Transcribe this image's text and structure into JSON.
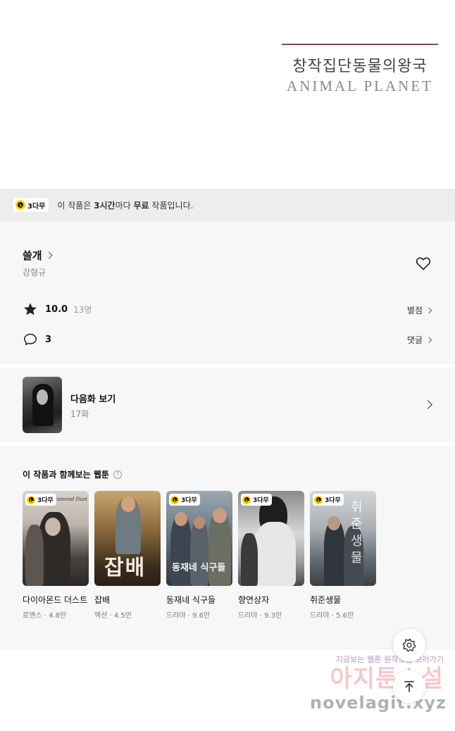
{
  "logo": {
    "kr": "창작집단동물의왕국",
    "en": "ANIMAL PLANET"
  },
  "notice": {
    "badge": "3다무",
    "text_prefix": "이 작품은 ",
    "text_hours": "3시간",
    "text_mid": "마다 ",
    "text_free": "무료",
    "text_suffix": " 작품입니다."
  },
  "work": {
    "title": "쓸개",
    "author": "강형규",
    "rating": "10.0",
    "rating_count": "13명",
    "rating_link": "별점",
    "comments": "3",
    "comments_link": "댓글"
  },
  "next_episode": {
    "label": "다음화 보기",
    "episode": "17화"
  },
  "recommendations": {
    "heading": "이 작품과 함께보는 웹툰",
    "help": "?",
    "items": [
      {
        "badge": "3다무",
        "title": "다이아몬드 더스트",
        "meta": "로맨스 · 4.8만",
        "cover_text": "Diamond Dust"
      },
      {
        "badge": "",
        "title": "잡배",
        "meta": "액션 · 4.5만",
        "cover_text": "잡배"
      },
      {
        "badge": "3다무",
        "title": "동재네 식구들",
        "meta": "드라마 · 9.6만",
        "cover_text": "동재네 식구들"
      },
      {
        "badge": "3다무",
        "title": "향연상자",
        "meta": "드라마 · 9.3만",
        "cover_text": ""
      },
      {
        "badge": "3다무",
        "title": "취준생물",
        "meta": "드라마 · 5.6만",
        "cover_text": "취준생물"
      }
    ]
  },
  "watermark": {
    "line1": "지금보는 웹툰 원작소설 보러가기",
    "line2": "아지툰소설",
    "line3": "novelagit.xyz"
  },
  "icons": {
    "clock": "clock-icon",
    "heart": "heart-icon",
    "star": "star-icon",
    "comment": "comment-icon",
    "gear": "gear-icon",
    "arrow_up": "arrow-up-icon"
  },
  "colors": {
    "badge_yellow": "#ffd400",
    "section_bg": "#f7f7f7",
    "notice_bg": "#ededed"
  }
}
